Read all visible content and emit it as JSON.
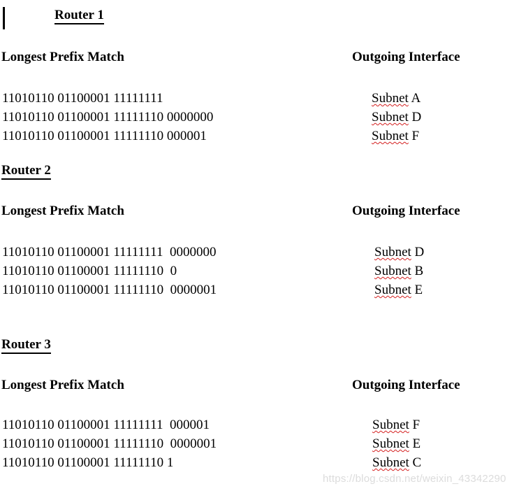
{
  "document": {
    "type": "word-processor-document",
    "caret_visible": true,
    "headings": {
      "left_column": "Longest Prefix Match",
      "right_column": "Outgoing Interface"
    },
    "spellcheck_word": "Subnet",
    "spellcheck_color": "#d42020"
  },
  "sections": [
    {
      "title": "Router 1",
      "left_heading": "Longest Prefix Match",
      "right_heading": "Outgoing Interface",
      "rows": [
        {
          "prefix": "11010110 01100001 11111111",
          "interface_word": "Subnet",
          "interface_letter": " A"
        },
        {
          "prefix": "11010110 01100001 11111110 0000000",
          "interface_word": "Subnet",
          "interface_letter": " D"
        },
        {
          "prefix": "11010110 01100001 11111110 000001",
          "interface_word": "Subnet",
          "interface_letter": " F"
        }
      ]
    },
    {
      "title": "Router 2",
      "left_heading": "Longest Prefix Match",
      "right_heading": "Outgoing Interface",
      "rows": [
        {
          "prefix": "11010110 01100001 11111111  0000000",
          "interface_word": "Subnet",
          "interface_letter": " D"
        },
        {
          "prefix": "11010110 01100001 11111110  0",
          "interface_word": "Subnet",
          "interface_letter": " B"
        },
        {
          "prefix": "11010110 01100001 11111110  0000001",
          "interface_word": "Subnet",
          "interface_letter": " E"
        }
      ]
    },
    {
      "title": "Router 3",
      "left_heading": "Longest Prefix Match",
      "right_heading": "Outgoing Interface",
      "rows": [
        {
          "prefix": "11010110 01100001 11111111  000001",
          "interface_word": "Subnet",
          "interface_letter": " F"
        },
        {
          "prefix": "11010110 01100001 11111110  0000001",
          "interface_word": "Subnet",
          "interface_letter": " E"
        },
        {
          "prefix": "11010110 01100001 11111110 1",
          "interface_word": "Subnet",
          "interface_letter": " C"
        }
      ]
    }
  ],
  "watermark": {
    "text": "https://blog.csdn.net/weixin_43342290",
    "color": "#dcdcdc"
  }
}
